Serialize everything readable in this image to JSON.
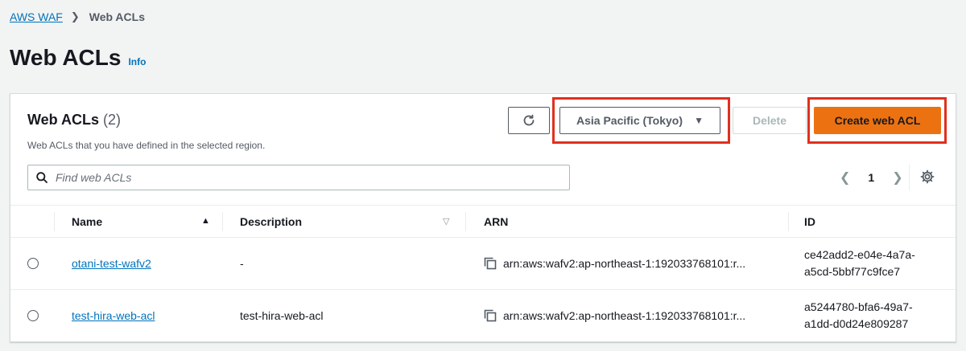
{
  "breadcrumb": {
    "parent": "AWS WAF",
    "current": "Web ACLs"
  },
  "page": {
    "title": "Web ACLs",
    "info": "Info"
  },
  "panel": {
    "title": "Web ACLs",
    "count": "(2)",
    "description": "Web ACLs that you have defined in the selected region."
  },
  "toolbar": {
    "region": "Asia Pacific (Tokyo)",
    "delete_label": "Delete",
    "create_label": "Create web ACL"
  },
  "search": {
    "placeholder": "Find web ACLs"
  },
  "pagination": {
    "current_page": "1",
    "prev_icon": "chevron-left-icon",
    "next_icon": "chevron-right-icon"
  },
  "table": {
    "columns": {
      "name": "Name",
      "description": "Description",
      "arn": "ARN",
      "id": "ID"
    },
    "rows": [
      {
        "name": "otani-test-wafv2",
        "description": "-",
        "arn": "arn:aws:wafv2:ap-northeast-1:192033768101:r...",
        "id": "ce42add2-e04e-4a7a-a5cd-5bbf77c9fce7"
      },
      {
        "name": "test-hira-web-acl",
        "description": "test-hira-web-acl",
        "arn": "arn:aws:wafv2:ap-northeast-1:192033768101:r...",
        "id": "a5244780-bfa6-49a7-a1dd-d0d24e809287"
      }
    ]
  },
  "colors": {
    "primary_button": "#ec7211",
    "link": "#0073bb",
    "highlight_annotation": "#e0301e"
  }
}
